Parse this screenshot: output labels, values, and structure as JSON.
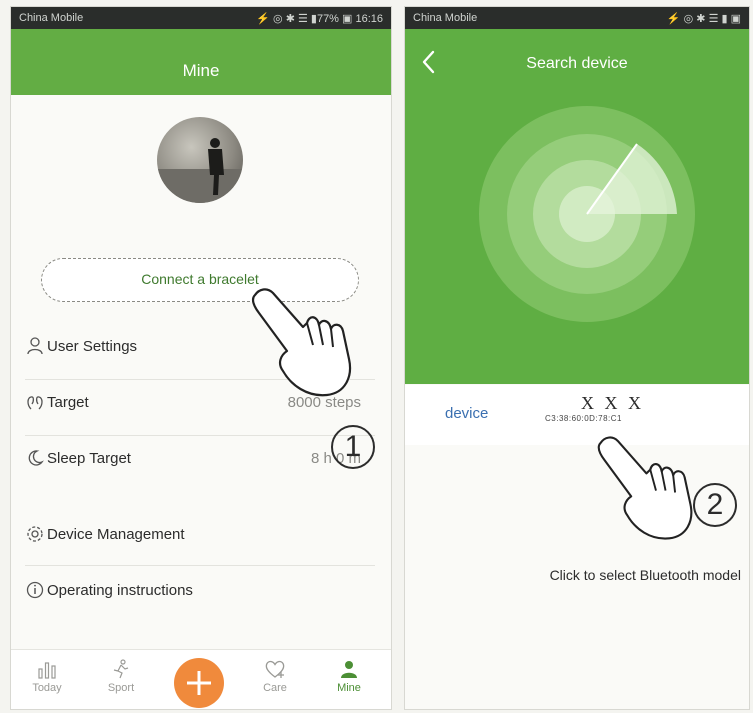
{
  "left_screen": {
    "status_bar": {
      "carrier": "China Mobile",
      "indicators": "⚡ ◎ ✱ ☰ ▮77% ▣ 16:16"
    },
    "title": "Mine",
    "connect_button": "Connect a bracelet",
    "menu": [
      {
        "icon": "user-icon",
        "label": "User Settings",
        "value": ""
      },
      {
        "icon": "target-icon",
        "label": "Target",
        "value": "8000 steps"
      },
      {
        "icon": "moon-icon",
        "label": "Sleep Target",
        "value": "8 h 0 m"
      },
      {
        "icon": "gear-icon",
        "label": "Device Management",
        "value": ""
      },
      {
        "icon": "info-icon",
        "label": "Operating instructions",
        "value": ""
      }
    ],
    "bottom_nav": [
      {
        "icon": "bar-chart-icon",
        "label": "Today"
      },
      {
        "icon": "runner-icon",
        "label": "Sport"
      },
      {
        "icon": "plus-icon",
        "label": ""
      },
      {
        "icon": "heart-icon",
        "label": "Care"
      },
      {
        "icon": "person-icon",
        "label": "Mine"
      }
    ],
    "step_number": "1",
    "colors": {
      "header_green": "#63ad44",
      "add_orange": "#f08a3c",
      "accent_text": "#3f7a2e"
    }
  },
  "right_screen": {
    "status_bar": {
      "carrier": "China Mobile",
      "indicators": "⚡ ◎ ✱ ☰ ▮ ▣"
    },
    "title": "Search device",
    "device": {
      "label": "device",
      "name": "X X X",
      "mac": "C3:38:60:0D:78:C1"
    },
    "hint": "Click to select Bluetooth model",
    "step_number": "2",
    "colors": {
      "radar_green": "#5fae43",
      "device_label_blue": "#3a6fb0"
    }
  }
}
